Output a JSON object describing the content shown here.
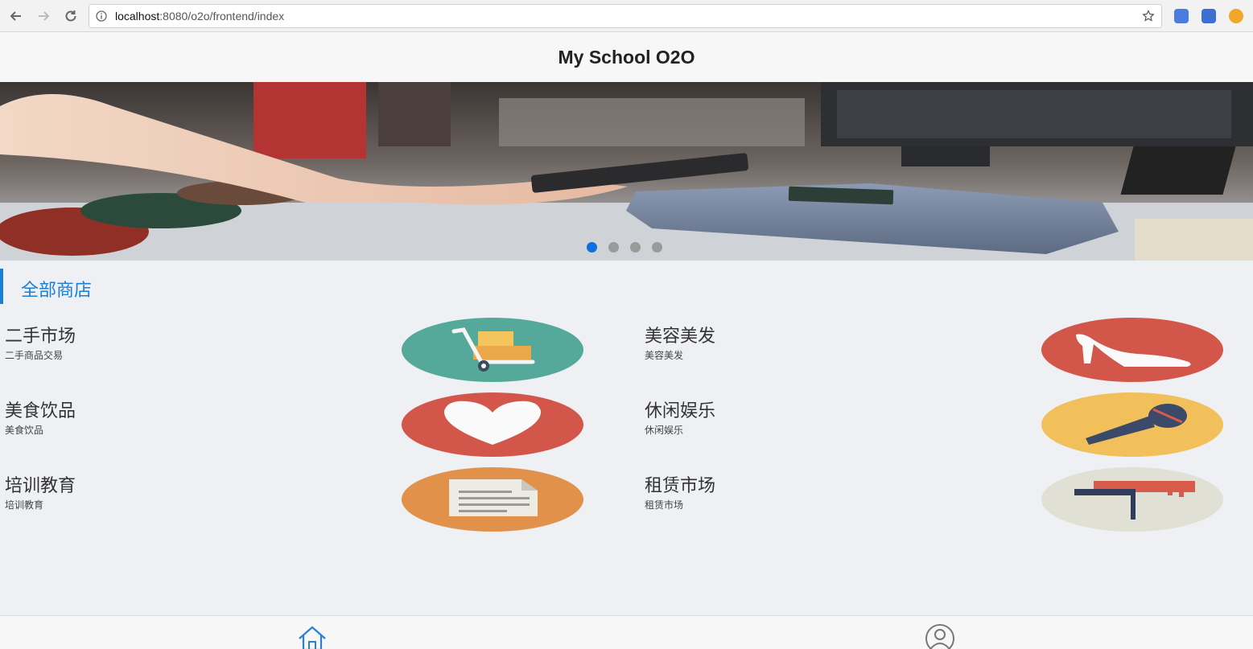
{
  "browser": {
    "url_host": "localhost",
    "url_rest": ":8080/o2o/frontend/index"
  },
  "header": {
    "title": "My School O2O"
  },
  "carousel": {
    "slide_count": 4,
    "active_index": 0
  },
  "section": {
    "title": "全部商店"
  },
  "categories": [
    {
      "name": "二手市场",
      "desc": "二手商品交易",
      "icon": "hand-truck-icon",
      "color": "#55a99a"
    },
    {
      "name": "美容美发",
      "desc": "美容美发",
      "icon": "high-heel-icon",
      "color": "#d2574a"
    },
    {
      "name": "美食饮品",
      "desc": "美食饮品",
      "icon": "heart-icon",
      "color": "#d2574a"
    },
    {
      "name": "休闲娱乐",
      "desc": "休闲娱乐",
      "icon": "microphone-icon",
      "color": "#f1c05a"
    },
    {
      "name": "培训教育",
      "desc": "培训教育",
      "icon": "document-icon",
      "color": "#e2914a"
    },
    {
      "name": "租赁市场",
      "desc": "租赁市场",
      "icon": "key-icon",
      "color": "#e0e0d4"
    }
  ],
  "tabs": [
    {
      "icon": "home-icon"
    },
    {
      "icon": "user-icon"
    }
  ]
}
